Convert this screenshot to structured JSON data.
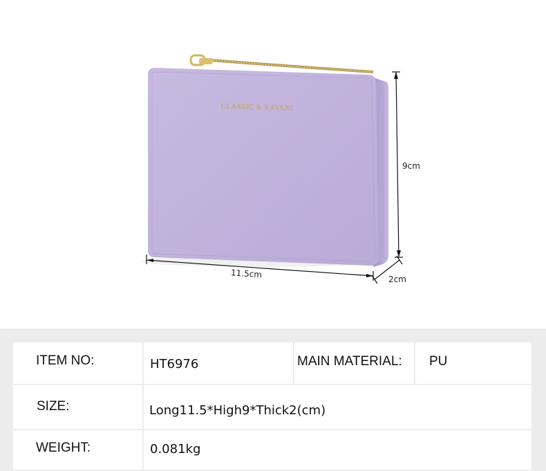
{
  "product": {
    "brand_text": "CLASSIC & RAVANI",
    "color_hex": "#c2b4dc",
    "dimensions": {
      "width_label": "11.5cm",
      "height_label": "9cm",
      "thickness_label": "2cm"
    }
  },
  "specs": {
    "item_no": {
      "label": "ITEM NO:",
      "value": "HT6976"
    },
    "material": {
      "label": "MAIN MATERIAL:",
      "value": "PU"
    },
    "size": {
      "label": "SIZE:",
      "value": "Long11.5*High9*Thick2(cm)"
    },
    "weight": {
      "label": "WEIGHT:",
      "value": "0.081kg"
    }
  }
}
